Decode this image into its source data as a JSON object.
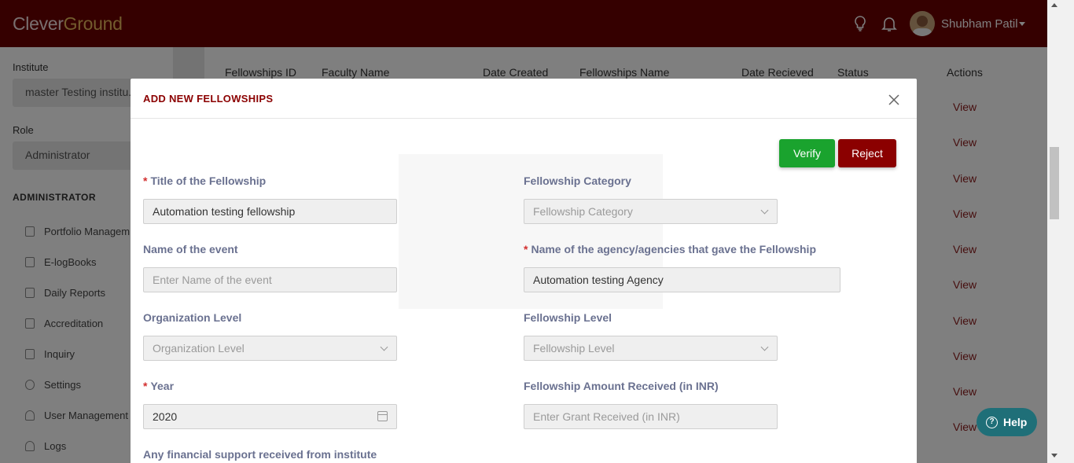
{
  "header": {
    "logo_part1": "Clever",
    "logo_part2": "Ground",
    "user_name": "Shubham Patil"
  },
  "sidebar": {
    "institute_label": "Institute",
    "institute_value": "master Testing institu...",
    "role_label": "Role",
    "role_value": "Administrator",
    "section_title": "ADMINISTRATOR",
    "items": [
      {
        "label": "Portfolio Managem",
        "icon": "trophy-icon"
      },
      {
        "label": "E-logBooks",
        "icon": "book-icon"
      },
      {
        "label": "Daily Reports",
        "icon": "book-icon"
      },
      {
        "label": "Accreditation",
        "icon": "calendar-icon"
      },
      {
        "label": "Inquiry",
        "icon": "book-icon"
      },
      {
        "label": "Settings",
        "icon": "gear-icon"
      },
      {
        "label": "User Management",
        "icon": "users-icon"
      },
      {
        "label": "Logs",
        "icon": "user-icon"
      }
    ]
  },
  "table": {
    "columns": [
      "Fellowships ID",
      "Faculty Name",
      "Date Created",
      "Fellowships Name",
      "Date Recieved",
      "Status",
      "Actions"
    ],
    "action_label": "View"
  },
  "modal": {
    "title": "ADD NEW FELLOWSHIPS",
    "verify_label": "Verify",
    "reject_label": "Reject",
    "fields": {
      "title_label": "Title of the Fellowship",
      "title_value": "Automation testing fellowship",
      "category_label": "Fellowship Category",
      "category_placeholder": "Fellowship Category",
      "event_label": "Name of the event",
      "event_placeholder": "Enter Name of the event",
      "agency_label": "Name of the agency/agencies that gave the Fellowship",
      "agency_value": "Automation testing Agency",
      "org_level_label": "Organization Level",
      "org_level_placeholder": "Organization Level",
      "fellowship_level_label": "Fellowship Level",
      "fellowship_level_placeholder": "Fellowship Level",
      "year_label": "Year",
      "year_value": "2020",
      "amount_label": "Fellowship Amount Received (in INR)",
      "amount_placeholder": "Enter Grant Received (in INR)",
      "support_label": "Any financial support received from institute"
    },
    "required_mark": "*"
  },
  "help": {
    "label": "Help",
    "icon_glyph": "?"
  },
  "colors": {
    "brand": "#6b0000",
    "verify": "#1aa32e",
    "reject": "#8b0000",
    "help": "#1f6f78"
  }
}
